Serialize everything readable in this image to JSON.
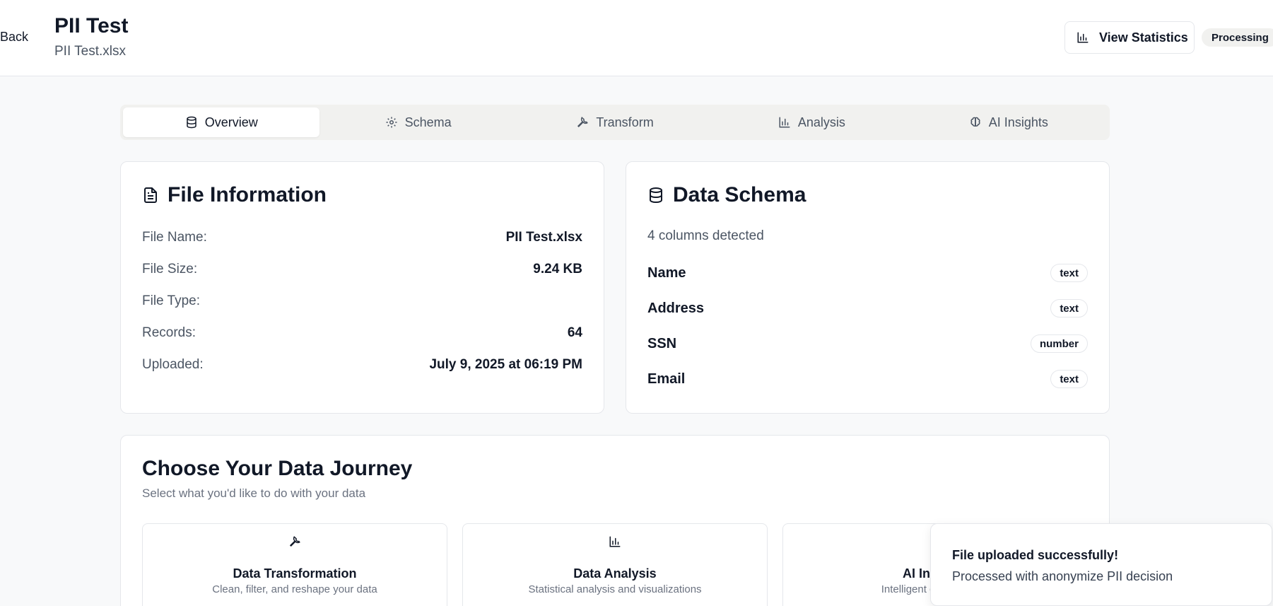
{
  "header": {
    "back_label": "Back",
    "title": "PII Test",
    "subtitle": "PII Test.xlsx",
    "view_statistics_label": "View Statistics",
    "status_badge": "Processing"
  },
  "tabs": [
    {
      "label": "Overview",
      "icon": "database-icon",
      "active": true
    },
    {
      "label": "Schema",
      "icon": "gear-icon",
      "active": false
    },
    {
      "label": "Transform",
      "icon": "wrench-icon",
      "active": false
    },
    {
      "label": "Analysis",
      "icon": "bar-chart-icon",
      "active": false
    },
    {
      "label": "AI Insights",
      "icon": "brain-icon",
      "active": false
    }
  ],
  "file_info": {
    "title": "File Information",
    "rows": [
      {
        "label": "File Name:",
        "value": "PII Test.xlsx"
      },
      {
        "label": "File Size:",
        "value": "9.24 KB"
      },
      {
        "label": "File Type:",
        "value": ""
      },
      {
        "label": "Records:",
        "value": "64"
      },
      {
        "label": "Uploaded:",
        "value": "July 9, 2025 at 06:19 PM"
      }
    ]
  },
  "data_schema": {
    "title": "Data Schema",
    "summary": "4 columns detected",
    "columns": [
      {
        "name": "Name",
        "type": "text"
      },
      {
        "name": "Address",
        "type": "text"
      },
      {
        "name": "SSN",
        "type": "number"
      },
      {
        "name": "Email",
        "type": "text"
      }
    ]
  },
  "journey": {
    "title": "Choose Your Data Journey",
    "subtitle": "Select what you'd like to do with your data",
    "options": [
      {
        "title": "Data Transformation",
        "description": "Clean, filter, and reshape your data",
        "icon": "wrench-icon"
      },
      {
        "title": "Data Analysis",
        "description": "Statistical analysis and visualizations",
        "icon": "bar-chart-icon"
      },
      {
        "title": "AI Insights",
        "description": "Intelligent data insights",
        "icon": "brain-icon"
      }
    ]
  },
  "toast": {
    "title": "File uploaded successfully!",
    "description": "Processed with anonymize PII decision"
  },
  "colors": {
    "background": "#f8f9fa",
    "card": "#ffffff",
    "border": "#e5e7eb",
    "text_primary": "#111827",
    "text_muted": "#4b5563",
    "tab_bar": "#f1f1ef"
  }
}
